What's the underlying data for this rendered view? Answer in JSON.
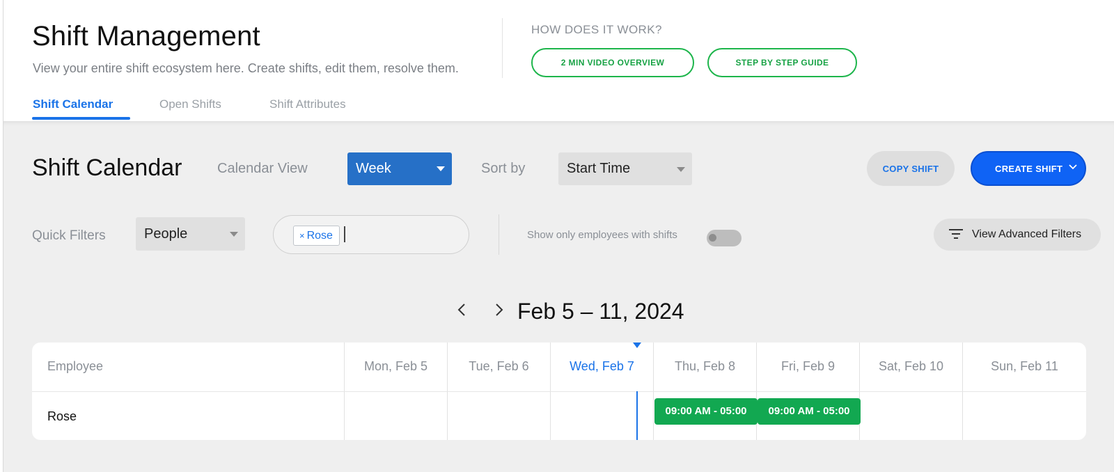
{
  "header": {
    "title": "Shift Management",
    "subtitle": "View your entire shift ecosystem here. Create shifts, edit them, resolve them.",
    "how_label": "HOW DOES IT WORK?",
    "video_button": "2 MIN VIDEO OVERVIEW",
    "guide_button": "STEP BY STEP GUIDE",
    "tabs": [
      {
        "label": "Shift Calendar",
        "active": true
      },
      {
        "label": "Open Shifts",
        "active": false
      },
      {
        "label": "Shift Attributes",
        "active": false
      }
    ]
  },
  "toolbar": {
    "section_title": "Shift Calendar",
    "calendar_view_label": "Calendar View",
    "calendar_view_value": "Week",
    "sort_label": "Sort by",
    "sort_value": "Start Time",
    "copy_button": "COPY SHIFT",
    "create_button": "CREATE SHIFT"
  },
  "filters": {
    "quick_label": "Quick Filters",
    "people_value": "People",
    "chip_label": "Rose",
    "chip_remove": "×",
    "show_only_label": "Show only employees with shifts",
    "show_only_on": false,
    "advanced_button": "View Advanced Filters"
  },
  "calendar": {
    "range": "Feb 5 – 11, 2024",
    "employee_header": "Employee",
    "days": [
      "Mon, Feb 5",
      "Tue, Feb 6",
      "Wed, Feb 7",
      "Thu, Feb 8",
      "Fri, Feb 9",
      "Sat, Feb 10",
      "Sun, Feb 11"
    ],
    "today_index": 2,
    "rows": [
      {
        "employee": "Rose",
        "shifts": [
          {
            "day_index": 3,
            "label": "09:00 AM - 05:00"
          },
          {
            "day_index": 4,
            "label": "09:00 AM - 05:00"
          }
        ]
      }
    ]
  },
  "colors": {
    "accent": "#1a73e8",
    "primary_button": "#0f63f5",
    "select_active": "#2670c7",
    "shift_green": "#12a851",
    "outline_green": "#1db54b"
  }
}
